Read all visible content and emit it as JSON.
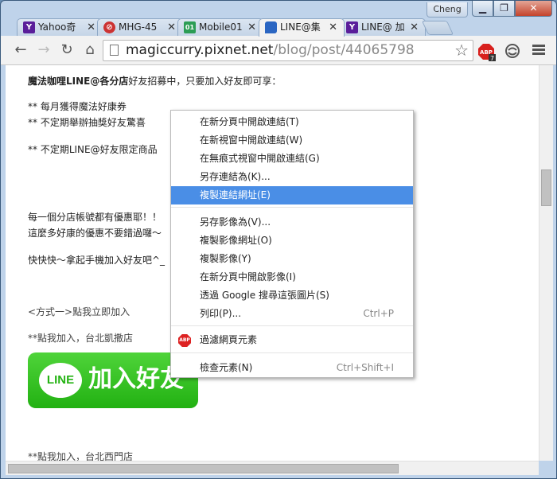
{
  "window": {
    "profile": "Cheng",
    "min": "▁",
    "max": "❐",
    "close": "✕"
  },
  "tabs": [
    {
      "label": "Yahoo奇",
      "favicon": "Y",
      "color": "#5a1e9a"
    },
    {
      "label": "MHG-45",
      "favicon": "⊘",
      "color": "#c33"
    },
    {
      "label": "Mobile01",
      "favicon": "01",
      "color": "#2c9d55"
    },
    {
      "label": "LINE@集",
      "favicon": "",
      "color": "#2b66c2",
      "active": true
    },
    {
      "label": "LINE@ 加",
      "favicon": "Y",
      "color": "#5a1e9a"
    }
  ],
  "toolbar": {
    "url_host": "magiccurry.pixnet.net",
    "url_path": "/blog/post/44065798",
    "back": "←",
    "forward": "→",
    "reload": "↻",
    "home": "⌂",
    "star": "☆",
    "abp": "ABP",
    "abp_count": "7"
  },
  "page": {
    "intro_bold": "魔法咖哩LINE@各分店",
    "intro_rest": "好友招募中，只要加入好友即可享：",
    "perk1": "** 每月獲得魔法好康券",
    "perk2": "** 不定期舉辦抽獎好友驚喜",
    "perk3": "** 不定期LINE@好友限定商品",
    "line1": "每一個分店帳號都有優惠耶！！",
    "line2": "這麼多好康的優惠不要錯過囉～",
    "line3": "快快快～拿起手機加入好友吧^_",
    "method": "<方式一>點我立即加入",
    "branch1": "**點我加入，台北凱撒店",
    "badge_logo": "LINE",
    "badge_text": "加入好友",
    "branch2": "**點我加入，台北西門店"
  },
  "context_menu": {
    "items": [
      {
        "label": "在新分頁中開啟連結(T)"
      },
      {
        "label": "在新視窗中開啟連結(W)"
      },
      {
        "label": "在無痕式視窗中開啟連結(G)"
      },
      {
        "label": "另存連結為(K)..."
      },
      {
        "label": "複製連結網址(E)",
        "highlighted": true
      },
      {
        "label": "另存影像為(V)..."
      },
      {
        "label": "複製影像網址(O)"
      },
      {
        "label": "複製影像(Y)"
      },
      {
        "label": "在新分頁中開啟影像(I)"
      },
      {
        "label": "透過 Google 搜尋這張圖片(S)"
      },
      {
        "label": "列印(P)...",
        "shortcut": "Ctrl+P"
      },
      {
        "label": "過濾網頁元素",
        "icon": "ABP"
      },
      {
        "label": "檢查元素(N)",
        "shortcut": "Ctrl+Shift+I"
      }
    ]
  }
}
